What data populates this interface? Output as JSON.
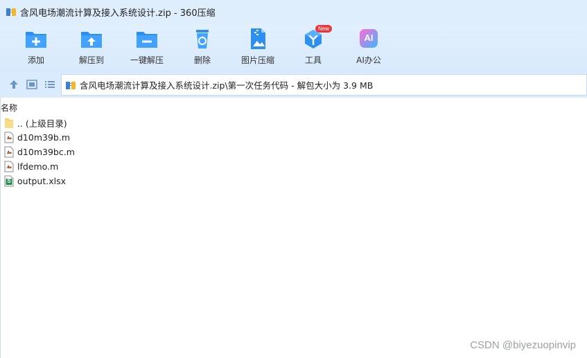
{
  "window": {
    "title": "含风电场潮流计算及接入系统设计.zip - 360压缩"
  },
  "toolbar": {
    "items": [
      {
        "label": "添加",
        "icon": "add-folder-icon"
      },
      {
        "label": "解压到",
        "icon": "extract-to-icon"
      },
      {
        "label": "一键解压",
        "icon": "one-click-extract-icon"
      },
      {
        "label": "删除",
        "icon": "recycle-bin-icon"
      },
      {
        "label": "图片压缩",
        "icon": "image-compress-icon"
      },
      {
        "label": "工具",
        "icon": "tools-icon",
        "badge": "New"
      },
      {
        "label": "AI办公",
        "icon": "ai-office-icon",
        "icon_text": "AI"
      }
    ]
  },
  "address": {
    "path": "含风电场潮流计算及接入系统设计.zip\\第一次任务代码 - 解包大小为 3.9 MB"
  },
  "list": {
    "column_header": "名称",
    "rows": [
      {
        "name": ".. (上级目录)",
        "icon": "folder-icon"
      },
      {
        "name": "d10m39b.m",
        "icon": "matlab-file-icon"
      },
      {
        "name": "d10m39bc.m",
        "icon": "matlab-file-icon"
      },
      {
        "name": "lfdemo.m",
        "icon": "matlab-file-icon"
      },
      {
        "name": "output.xlsx",
        "icon": "excel-file-icon",
        "icon_text": "S"
      }
    ]
  },
  "watermark": "CSDN @biyezuopinvip",
  "colors": {
    "titlebar_bg": "#dfeefd",
    "toolbar_bg": "#d9ebfc",
    "accent_blue": "#2d8ff0",
    "badge_red": "#e8383d",
    "ai_gradient_start": "#ff6bd6",
    "ai_gradient_end": "#3fb6ff",
    "excel_green": "#1e8f4e"
  }
}
